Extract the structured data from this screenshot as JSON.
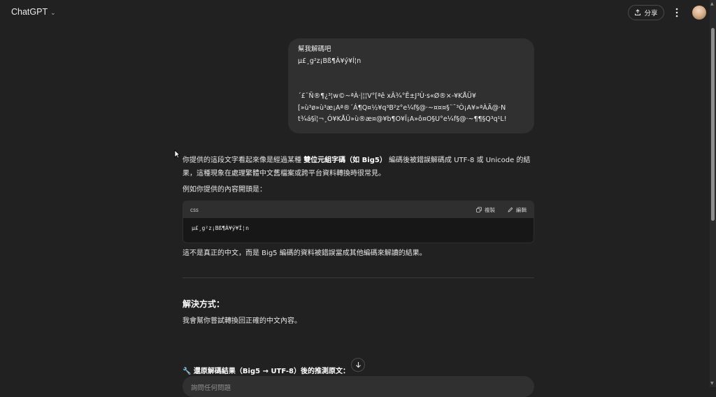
{
  "app": {
    "title": "ChatGPT"
  },
  "header": {
    "share_label": "分享"
  },
  "user_message": {
    "lines": [
      "幫我解碼吧",
      "µ£¸g²z¡Bß¶À¥ý¥Í¦n",
      "´£¨Ñ®¶¿³¦w©~ªÀ·|¦¦V°[ªê xÂ¾°Ê±J³Ù·s«Ø®×-¥KÅÜ¥",
      "[»ù³ø»ù³æ¡Aª®´Á¶Q¤½¥q³B²z°e¼f§@·~¤¤¤§¨¯³Ò¡A¥»ªÀÄ@·N",
      "t¾á§ï¦¬¸Ó¥KÅÜ»ù®æ¤@¥b¶O¥Î¡A»ô¤O§U°e¼f§@·~¶¶§Q³q¹L!"
    ]
  },
  "assistant": {
    "p1_a": "你提供的這段文字看起來像是經過某種 ",
    "p1_bold": "雙位元組字碼（如 Big5）",
    "p1_b": " 編碼後被錯誤解碼成 UTF-8 或 Unicode 的結果，這種現象在處理繁體中文舊檔案或跨平台資料轉換時很常見。",
    "p2": "例如你提供的內容開頭是：",
    "code": {
      "lang": "css",
      "copy_label": "複製",
      "edit_label": "編輯",
      "content": "µ£¸g²z¡Bß¶À¥ý¥Í¦n"
    },
    "p3": "這不是真正的中文，而是 Big5 編碼的資料被錯誤當成其他編碼來解讀的結果。",
    "section_title": "解決方式：",
    "p4": "我會幫你嘗試轉換回正確的中文內容。",
    "p5": "🔧 還原解碼結果（Big5 → UTF-8）後的推測原文："
  },
  "composer": {
    "placeholder": "詢問任何問題"
  },
  "icons": {
    "share": "upload-icon",
    "more": "vertical-dots-icon",
    "copy": "copy-icon",
    "edit": "pencil-icon",
    "scroll": "arrow-down-icon",
    "title_menu": "chevron-down-icon"
  }
}
